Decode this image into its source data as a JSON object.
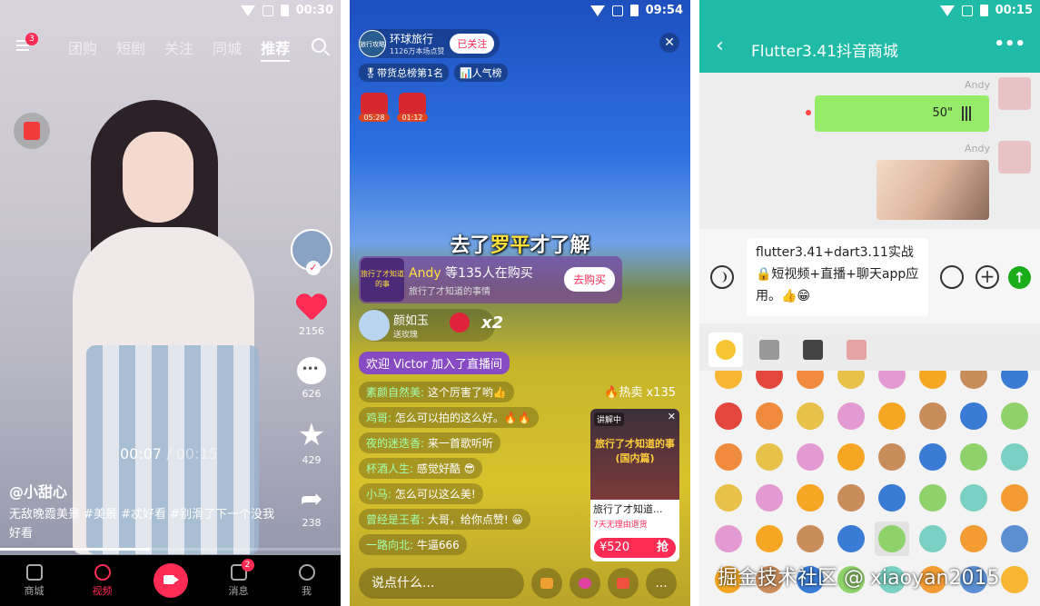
{
  "colors": {
    "accent": "#fe2c55",
    "header_green": "#1fbba6",
    "voice_bubble": "#95ec69",
    "live_purple": "#7b38de"
  },
  "phone1": {
    "status": {
      "time": "00:30"
    },
    "top": {
      "menu_badge": "3",
      "tabs": [
        "团购",
        "短剧",
        "关注",
        "同城",
        "推荐"
      ],
      "active_tab": "推荐"
    },
    "side": {
      "likes": "2156",
      "comments": "626",
      "favorites": "429",
      "shares": "238"
    },
    "player": {
      "current_time": "00:07",
      "separator": "/",
      "total_time": "00:15",
      "progress": 0.44
    },
    "author": "@小甜心",
    "description": "无敌晚霞美景 #美景 #忒好看 #别滑了下一个没我好看",
    "nav": {
      "items": [
        "商城",
        "视频",
        "消息",
        "我"
      ],
      "active": "视频",
      "message_badge": "2"
    }
  },
  "phone2": {
    "status": {
      "time": "09:54"
    },
    "host": {
      "avatar_text": "旅行攻略",
      "name": "环球旅行",
      "sub": "1126万本场点赞",
      "follow_label": "已关注"
    },
    "rank_tags": [
      "带货总榜第1名",
      "人气榜"
    ],
    "gifts": [
      {
        "time": "05:28"
      },
      {
        "time": "01:12"
      }
    ],
    "title_pre": "去了",
    "title_hl": "罗平",
    "title_post": "才了解",
    "buy_card": {
      "thumb_text": "旅行了才知道的事",
      "user": "Andy",
      "text": " 等135人在购买",
      "sub": "旅行了才知道的事情",
      "button": "去购买"
    },
    "gift_banner": {
      "name": "颜如玉",
      "sub": "送玫瑰",
      "combo": "x2"
    },
    "welcome": "欢迎 Victor 加入了直播间",
    "chat": [
      {
        "name": "素颜自然美:",
        "text": " 这个厉害了哟👍"
      },
      {
        "name": "鸡哥:",
        "text": " 怎么可以拍的这么好。🔥🔥"
      },
      {
        "name": "夜的迷迭香:",
        "text": " 来一首歌听听"
      },
      {
        "name": "杯酒人生:",
        "text": " 感觉好酷 😎"
      },
      {
        "name": "小马:",
        "text": " 怎么可以这么美!"
      },
      {
        "name": "曾经是王者:",
        "text": " 大哥，给你点赞! 😀"
      },
      {
        "name": "一路向北:",
        "text": " 牛逼666"
      }
    ],
    "hot": "🔥热卖 x135",
    "product": {
      "tag": "讲解中",
      "image_text": "旅行了才知道的事(国内篇)",
      "name": "旅行了才知道...",
      "note": "7天无理由退货",
      "price": "¥520",
      "buy": "抢"
    },
    "input_placeholder": "说点什么...",
    "more": "..."
  },
  "phone3": {
    "status": {
      "time": "00:15"
    },
    "header": {
      "title": "Flutter3.41抖音商城",
      "back": "‹",
      "more": "•••"
    },
    "messages": [
      {
        "sender": "Andy",
        "type": "voice",
        "duration": "50\""
      },
      {
        "sender": "Andy",
        "type": "image"
      }
    ],
    "compose_text": "flutter3.41+dart3.11实战🔒短视频+直播+聊天app应用。👍😁",
    "plus": "+",
    "send": "↑"
  },
  "watermark": "掘金技术社区 @ xiaoyan2015"
}
